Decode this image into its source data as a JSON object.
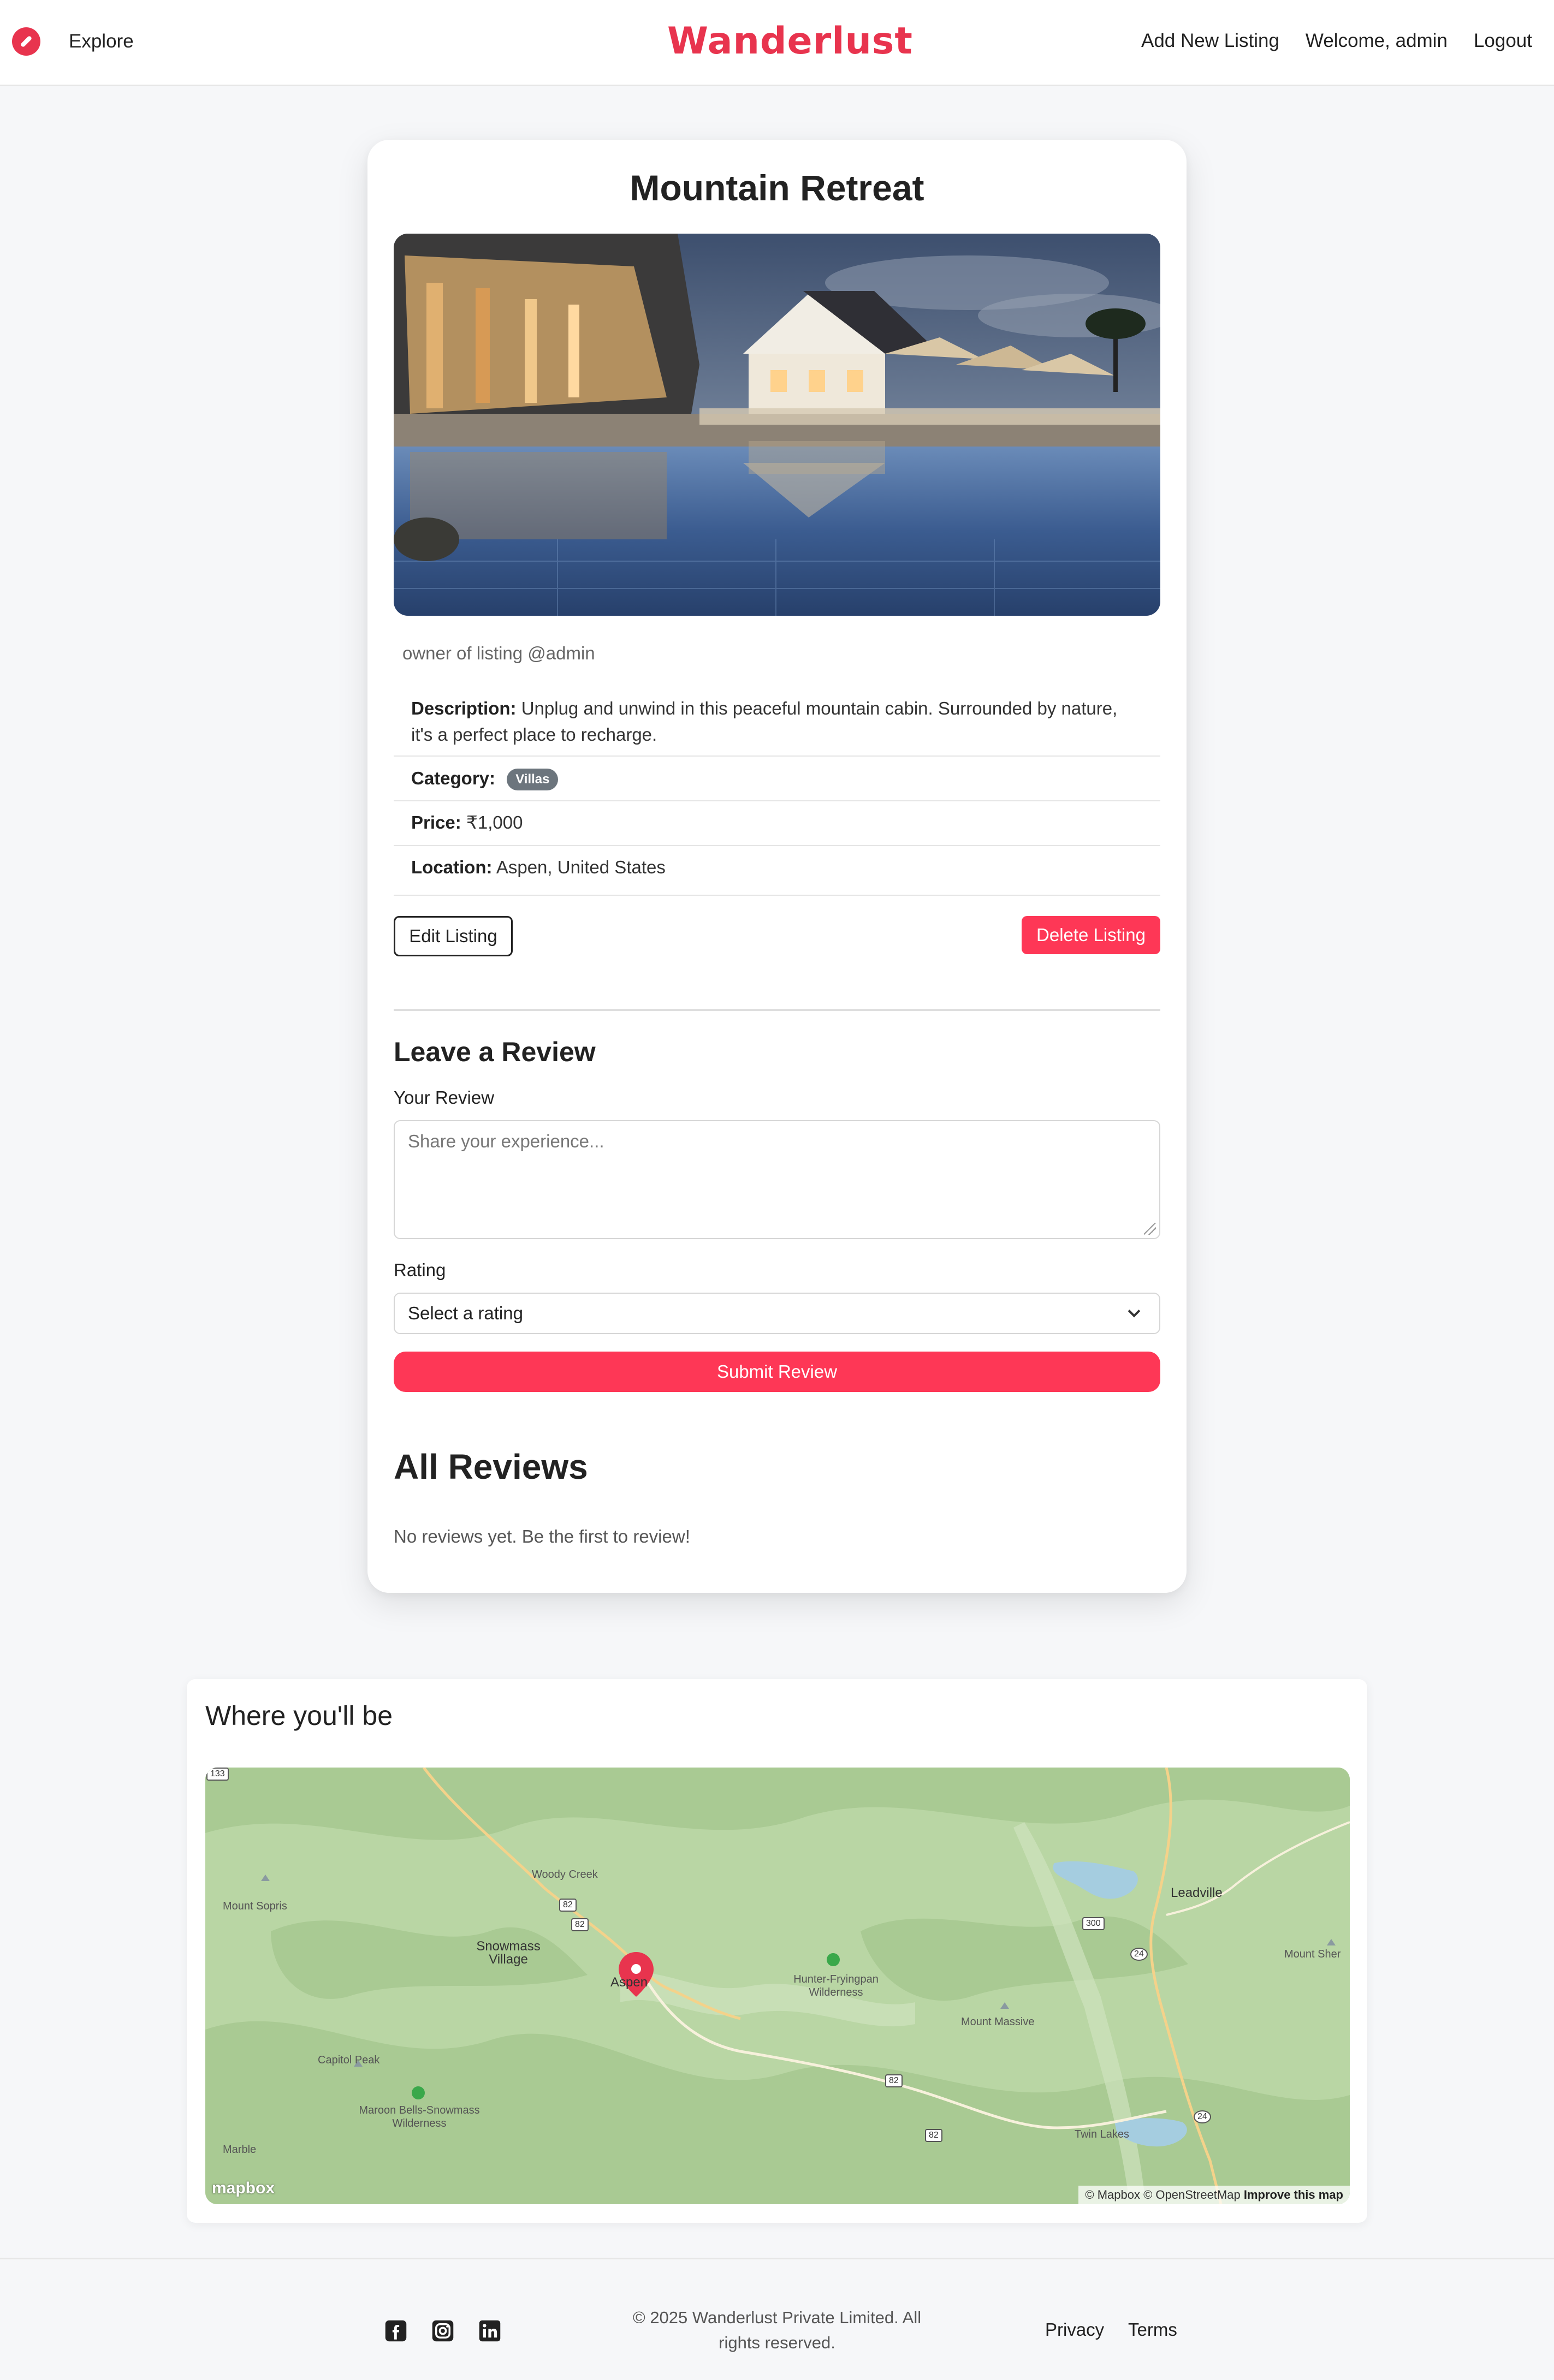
{
  "nav": {
    "explore": "Explore",
    "brand": "Wanderlust",
    "add_listing": "Add New Listing",
    "welcome": "Welcome, admin",
    "logout": "Logout"
  },
  "listing": {
    "title": "Mountain Retreat",
    "owner": "owner of listing @admin",
    "description_label": "Description:",
    "description": "Unplug and unwind in this peaceful mountain cabin. Surrounded by nature, it's a perfect place to recharge.",
    "category_label": "Category:",
    "category": "Villas",
    "price_label": "Price:",
    "price": "₹1,000",
    "location_label": "Location:",
    "location": "Aspen, United States",
    "edit_label": "Edit Listing",
    "delete_label": "Delete Listing"
  },
  "review_form": {
    "heading": "Leave a Review",
    "review_label": "Your Review",
    "review_placeholder": "Share your experience...",
    "rating_label": "Rating",
    "rating_selected": "Select a rating",
    "submit_label": "Submit Review"
  },
  "reviews": {
    "heading": "All Reviews",
    "empty": "No reviews yet. Be the first to review!"
  },
  "map": {
    "title": "Where you'll be",
    "labels": {
      "mount_sopris": "Mount Sopris",
      "woody_creek": "Woody Creek",
      "snowmass_village": "Snowmass Village",
      "aspen": "Aspen",
      "hunter_fryingpan": "Hunter-Fryingpan Wilderness",
      "mount_massive": "Mount Massive",
      "leadville": "Leadville",
      "mount_sherman": "Mount Sher",
      "capitol_peak": "Capitol Peak",
      "maroon_bells": "Maroon Bells-Snowmass Wilderness",
      "marble": "Marble",
      "twin_lakes": "Twin Lakes"
    },
    "shields": {
      "r133": "133",
      "r82a": "82",
      "r82b": "82",
      "r82c": "82",
      "r82d": "82",
      "r300": "300",
      "r24a": "24",
      "r24b": "24"
    },
    "logo": "mapbox",
    "attribution": "© Mapbox © OpenStreetMap",
    "improve": "Improve this map"
  },
  "footer": {
    "copyright": "© 2025 Wanderlust Private Limited. All rights reserved.",
    "privacy": "Privacy",
    "terms": "Terms"
  },
  "colors": {
    "brand": "#e8344e",
    "accent": "#fe3756",
    "badge": "#6c757d",
    "map_green": "#b9d6a4"
  },
  "icons": [
    "compass-icon",
    "facebook-icon",
    "instagram-icon",
    "linkedin-icon",
    "map-pin-icon",
    "chevron-down-icon"
  ]
}
